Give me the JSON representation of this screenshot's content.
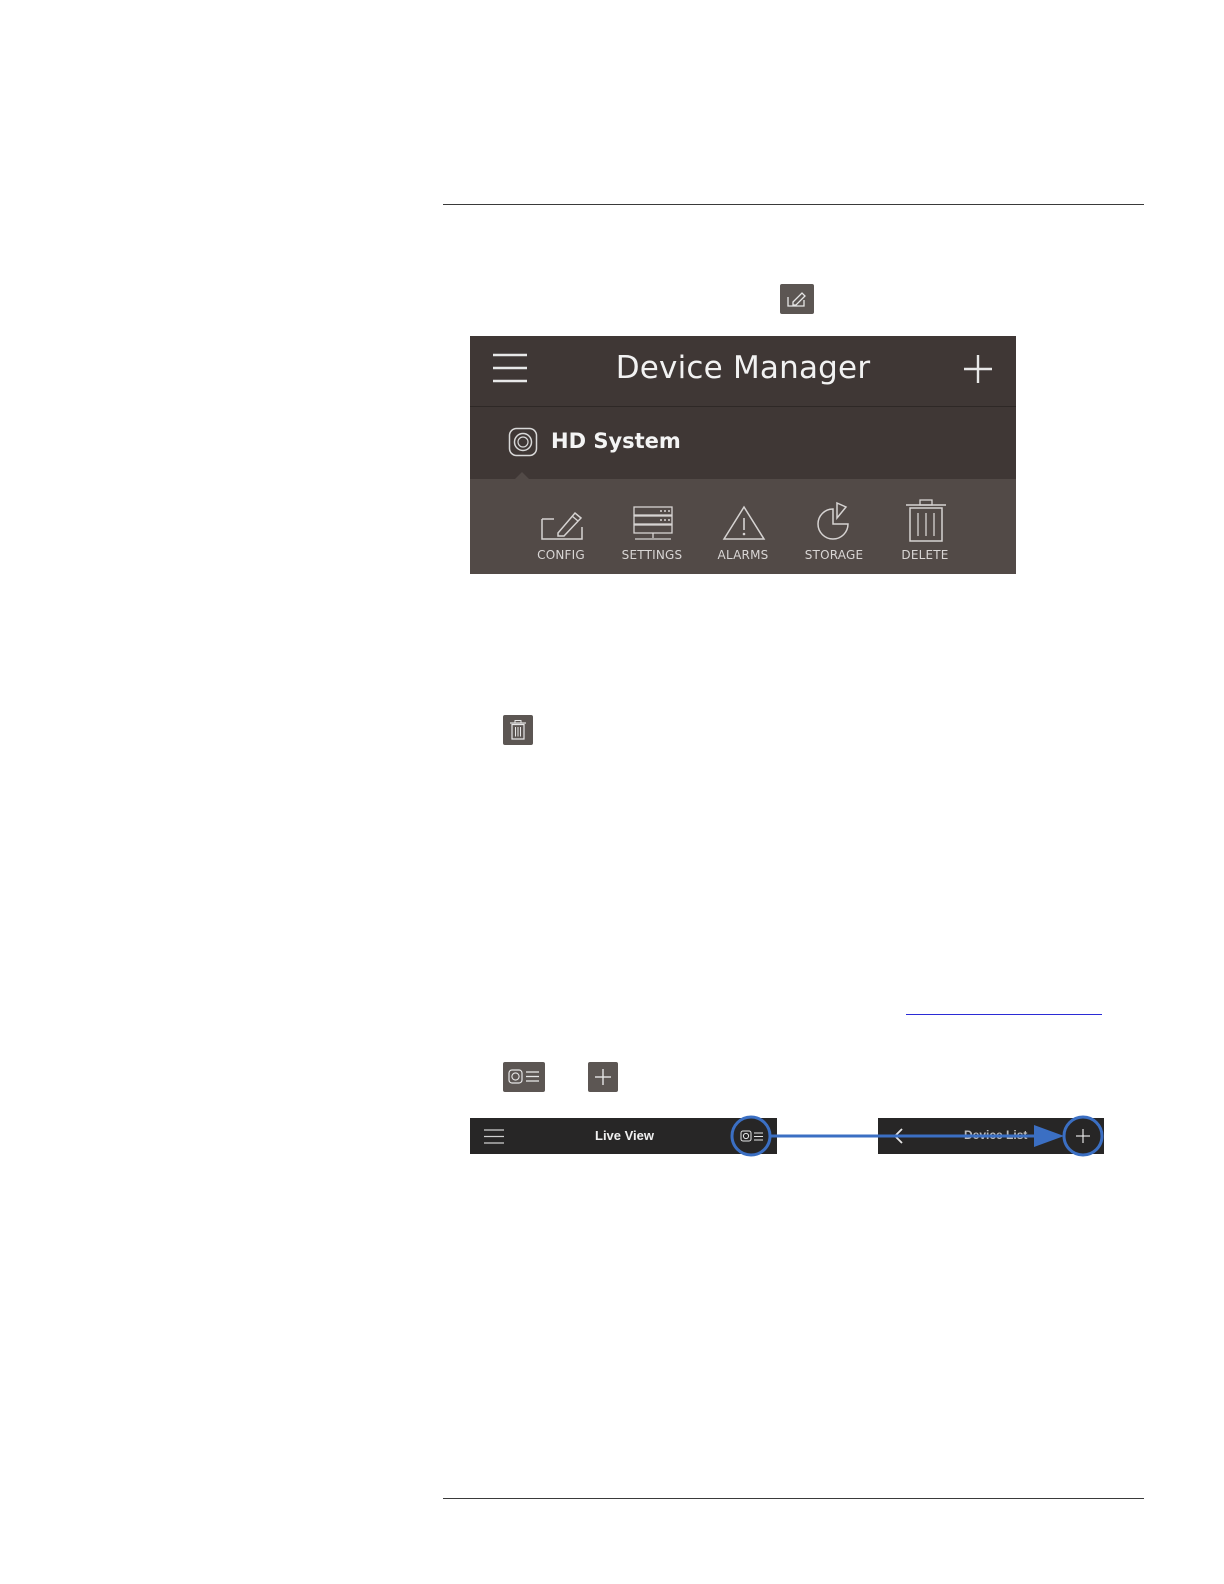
{
  "device_manager": {
    "title": "Device Manager",
    "device_name": "HD System",
    "actions": [
      {
        "label": "CONFIG",
        "icon": "config-icon"
      },
      {
        "label": "SETTINGS",
        "icon": "settings-icon"
      },
      {
        "label": "ALARMS",
        "icon": "alarm-icon"
      },
      {
        "label": "STORAGE",
        "icon": "storage-icon"
      },
      {
        "label": "DELETE",
        "icon": "delete-icon"
      }
    ],
    "colors": {
      "header": "#3f3735",
      "actions_bar": "#524a47",
      "text": "#f2f2f2"
    }
  },
  "inline_icons": [
    "edit-icon",
    "trash-icon",
    "device-list-icon",
    "plus-icon"
  ],
  "live_view_bar": {
    "title": "Live View"
  },
  "device_list_bar": {
    "title": "Device List"
  },
  "annotation_color": "#3b6fc3"
}
